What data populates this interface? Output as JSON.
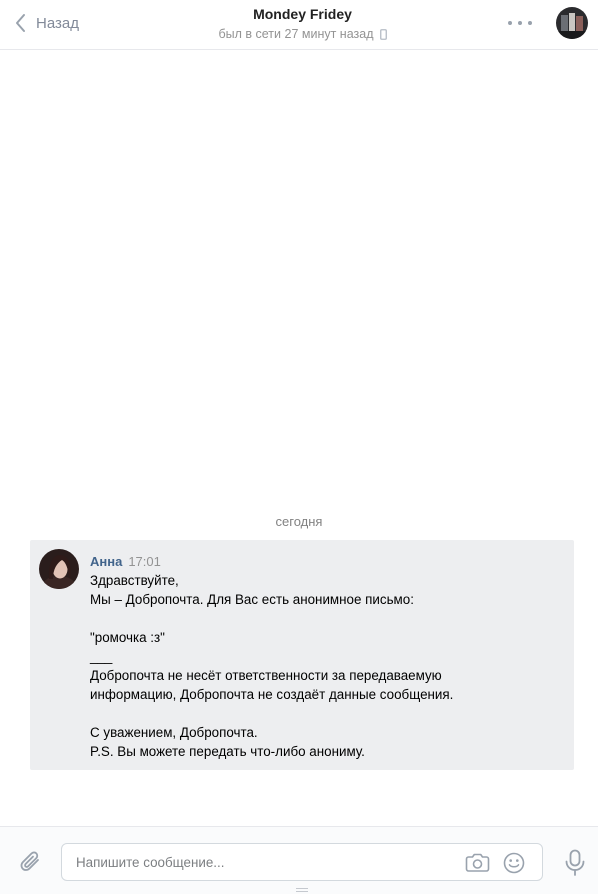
{
  "header": {
    "back_label": "Назад",
    "title": "Mondey Fridey",
    "status": "был в сети 27 минут назад"
  },
  "chat": {
    "date_separator": "сегодня",
    "messages": [
      {
        "author": "Анна",
        "time": "17:01",
        "lines": [
          "Здравствуйте,",
          "Мы – Добропочта. Для Вас есть анонимное письмо:",
          "",
          "\"ромочка :з\"",
          "___",
          "Добропочта не несёт ответственности за передаваемую",
          "информацию, Добропочта не создаёт данные сообщения.",
          "",
          "С уважением, Добропочта.",
          "P.S. Вы можете передать что-либо анониму."
        ]
      }
    ]
  },
  "composer": {
    "placeholder": "Напишите сообщение..."
  },
  "icons": {
    "back": "chevron-left-icon",
    "phone": "mobile-phone-icon",
    "more": "more-dots-icon",
    "attach": "paperclip-icon",
    "camera": "camera-icon",
    "emoji": "smile-icon",
    "mic": "microphone-icon"
  },
  "colors": {
    "author": "#42648b",
    "message_bg": "#edeef0",
    "muted": "#939393",
    "icon": "#99a2ad"
  }
}
